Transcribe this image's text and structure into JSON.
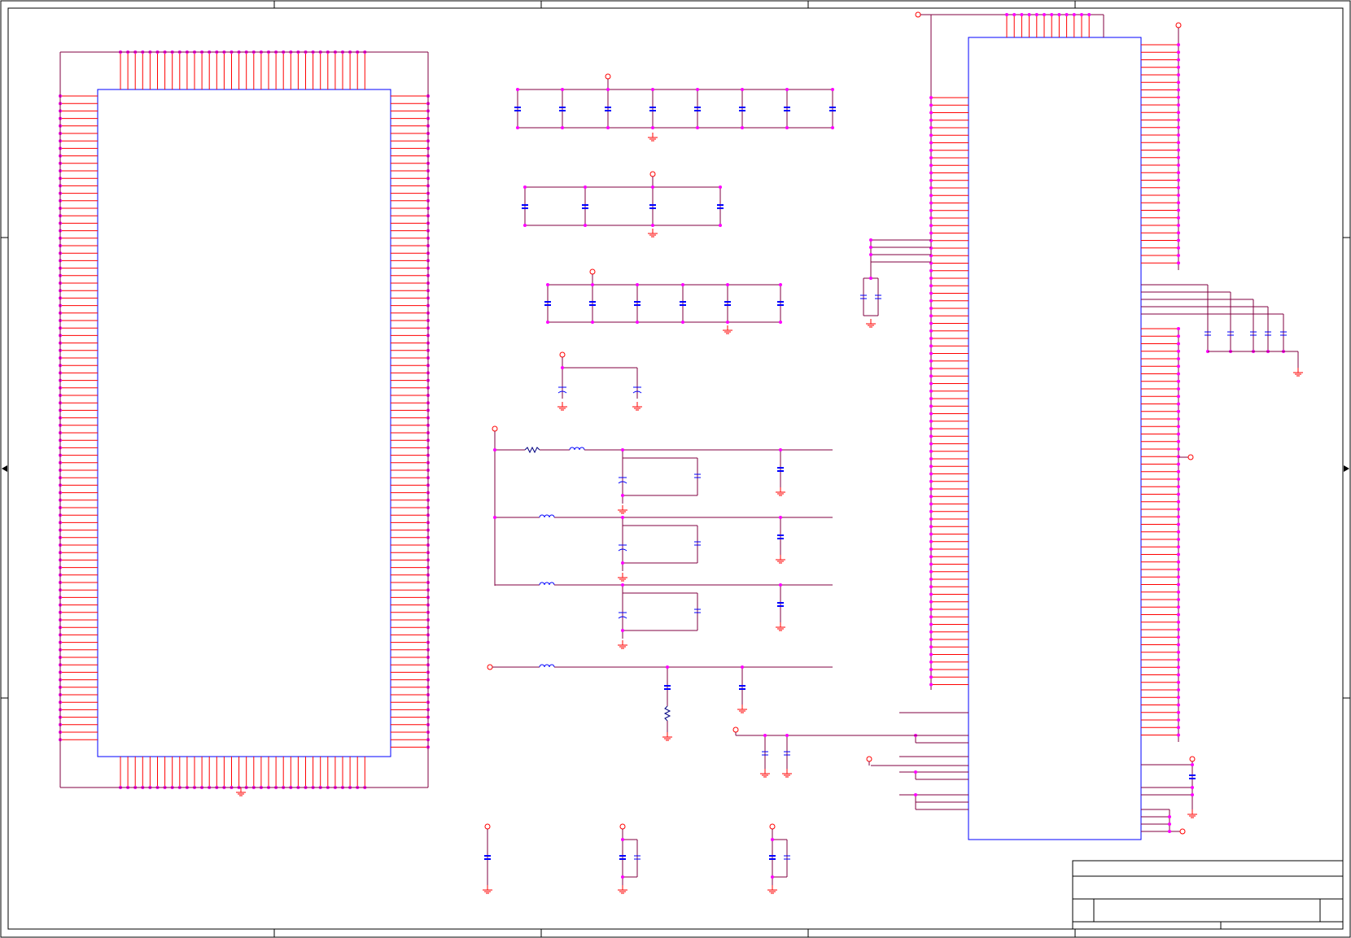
{
  "schematic": {
    "colors": {
      "wire": "#800040",
      "pin": "#ff0000",
      "chip_outline": "#0000ff",
      "junction": "#ff00ff",
      "power_ground": "#ff0000",
      "component": "#0000ff",
      "frame": "#000000"
    },
    "title_block": {
      "visible_text": ""
    }
  }
}
